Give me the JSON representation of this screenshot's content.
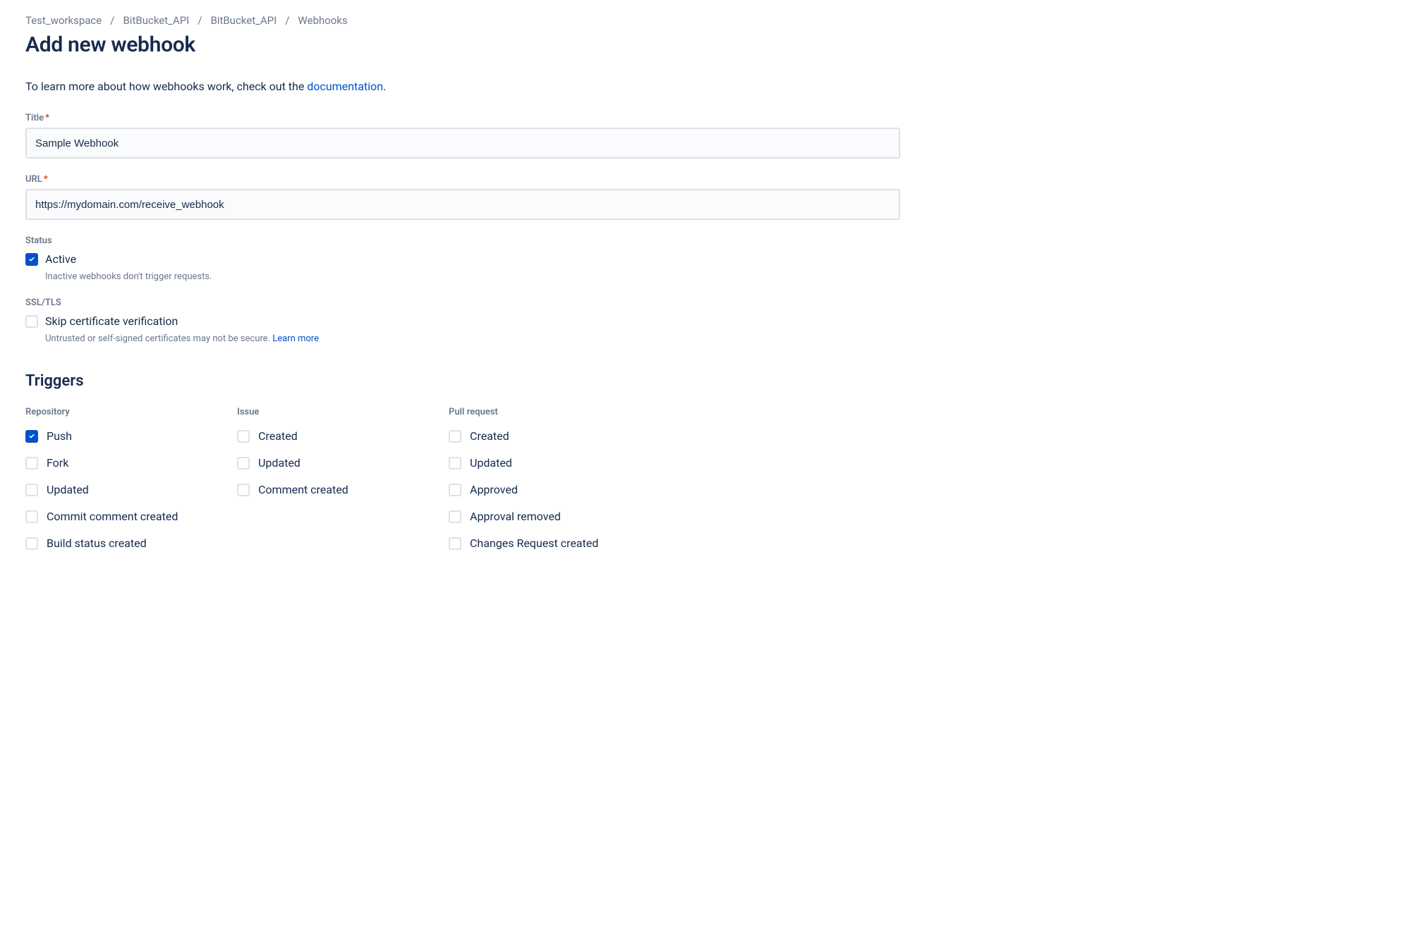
{
  "breadcrumbs": [
    "Test_workspace",
    "BitBucket_API",
    "BitBucket_API",
    "Webhooks"
  ],
  "page_title": "Add new webhook",
  "intro_prefix": "To learn more about how webhooks work, check out the ",
  "intro_link": "documentation",
  "intro_suffix": ".",
  "form": {
    "title_label": "Title",
    "title_value": "Sample Webhook",
    "url_label": "URL",
    "url_value": "https://mydomain.com/receive_webhook",
    "status_label": "Status",
    "status_active_label": "Active",
    "status_active_checked": true,
    "status_help": "Inactive webhooks don't trigger requests.",
    "ssl_label": "SSL/TLS",
    "ssl_skip_label": "Skip certificate verification",
    "ssl_skip_checked": false,
    "ssl_help_prefix": "Untrusted or self-signed certificates may not be secure. ",
    "ssl_learn_more": "Learn more"
  },
  "triggers": {
    "heading": "Triggers",
    "columns": [
      {
        "header": "Repository",
        "items": [
          {
            "label": "Push",
            "checked": true
          },
          {
            "label": "Fork",
            "checked": false
          },
          {
            "label": "Updated",
            "checked": false
          },
          {
            "label": "Commit comment created",
            "checked": false
          },
          {
            "label": "Build status created",
            "checked": false
          }
        ]
      },
      {
        "header": "Issue",
        "items": [
          {
            "label": "Created",
            "checked": false
          },
          {
            "label": "Updated",
            "checked": false
          },
          {
            "label": "Comment created",
            "checked": false
          }
        ]
      },
      {
        "header": "Pull request",
        "items": [
          {
            "label": "Created",
            "checked": false
          },
          {
            "label": "Updated",
            "checked": false
          },
          {
            "label": "Approved",
            "checked": false
          },
          {
            "label": "Approval removed",
            "checked": false
          },
          {
            "label": "Changes Request created",
            "checked": false
          }
        ]
      }
    ]
  }
}
